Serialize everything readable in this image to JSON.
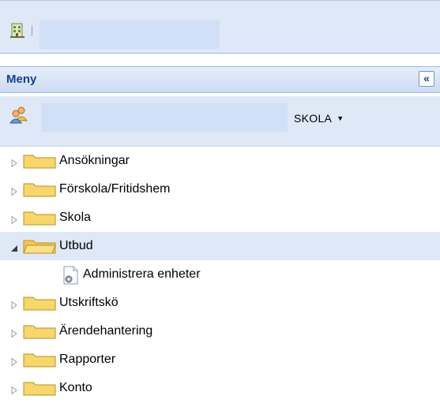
{
  "menu": {
    "title": "Meny",
    "collapse_glyph": "«"
  },
  "school_selector": {
    "value": "SKOLA",
    "caret": "▼"
  },
  "icons": {
    "top": "building-icon",
    "user": "users-icon",
    "folder": "folder-icon",
    "leaf": "settings-page-icon"
  },
  "colors": {
    "header_text": "#15428b",
    "panel_bg": "#dfe8f6",
    "selected_row": "#dfe8f6",
    "folder_fill": "#f7d66a"
  },
  "tree": [
    {
      "label": "Ansökningar",
      "expanded": false
    },
    {
      "label": "Förskola/Fritidshem",
      "expanded": false
    },
    {
      "label": "Skola",
      "expanded": false
    },
    {
      "label": "Utbud",
      "expanded": true,
      "selected": true,
      "children": [
        {
          "label": "Administrera enheter"
        }
      ]
    },
    {
      "label": "Utskriftskö",
      "expanded": false
    },
    {
      "label": "Ärendehantering",
      "expanded": false
    },
    {
      "label": "Rapporter",
      "expanded": false
    },
    {
      "label": "Konto",
      "expanded": false
    }
  ]
}
